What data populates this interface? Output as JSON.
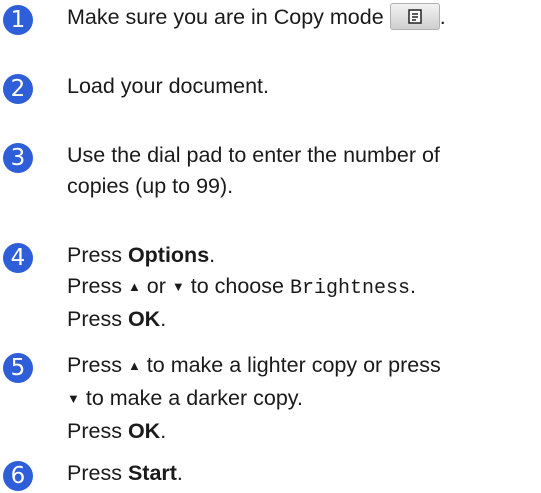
{
  "steps": [
    {
      "number": "1",
      "text_before_key": "Make sure you are in Copy mode",
      "text_after_key": "."
    },
    {
      "number": "2",
      "text": "Load your document."
    },
    {
      "number": "3",
      "line1": "Use the dial pad to enter the number of",
      "line2": "copies (up to 99)."
    },
    {
      "number": "4",
      "line1_pre": "Press ",
      "line1_bold": "Options",
      "line1_post": ".",
      "line2_pre": "Press ",
      "up_arrow": "▲",
      "line2_mid": " or ",
      "down_arrow": "▼",
      "line2_post": " to choose ",
      "line2_code": "Brightness",
      "line2_end": ".",
      "line3_pre": "Press ",
      "line3_bold": "OK",
      "line3_post": "."
    },
    {
      "number": "5",
      "line1_pre": "Press ",
      "up_arrow": "▲",
      "line1_post": " to make a lighter copy or press",
      "down_arrow": "▼",
      "line2_post": " to make a darker copy.",
      "line3_pre": "Press ",
      "line3_bold": "OK",
      "line3_post": "."
    },
    {
      "number": "6",
      "pre": "Press ",
      "bold": "Start",
      "post": "."
    }
  ],
  "copy_key_icon": "copy-document-icon",
  "badge_color": "#2f5fd8"
}
